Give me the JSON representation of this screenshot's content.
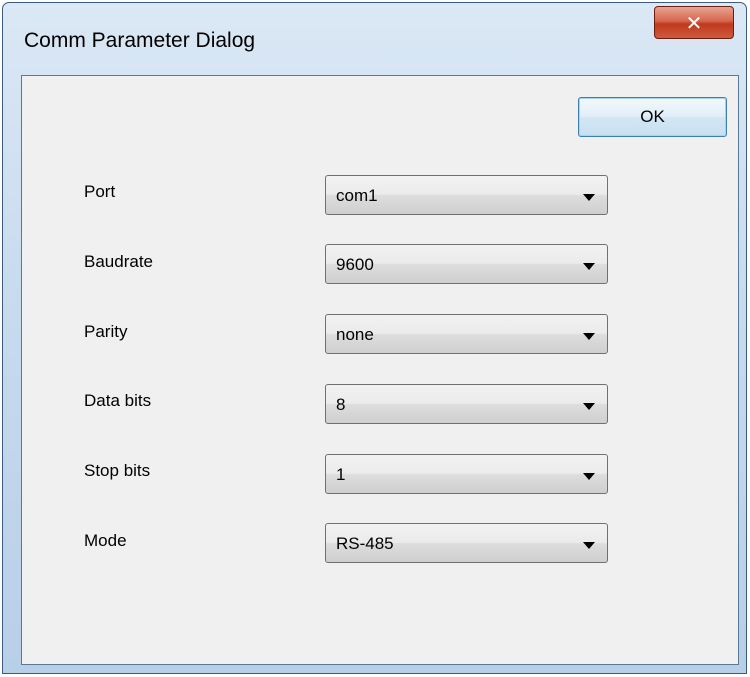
{
  "window": {
    "title": "Comm Parameter Dialog",
    "close_icon": "close-icon",
    "close_glyph": "✕"
  },
  "dialog": {
    "ok_label": "OK",
    "fields": [
      {
        "label": "Port",
        "value": "com1"
      },
      {
        "label": "Baudrate",
        "value": "9600"
      },
      {
        "label": "Parity",
        "value": "none"
      },
      {
        "label": "Data bits",
        "value": "8"
      },
      {
        "label": "Stop bits",
        "value": "1"
      },
      {
        "label": "Mode",
        "value": "RS-485"
      }
    ]
  },
  "colors": {
    "client_bg": "#f0f0f0",
    "close_button": "#c0391f",
    "ok_border": "#3c7fb1"
  }
}
